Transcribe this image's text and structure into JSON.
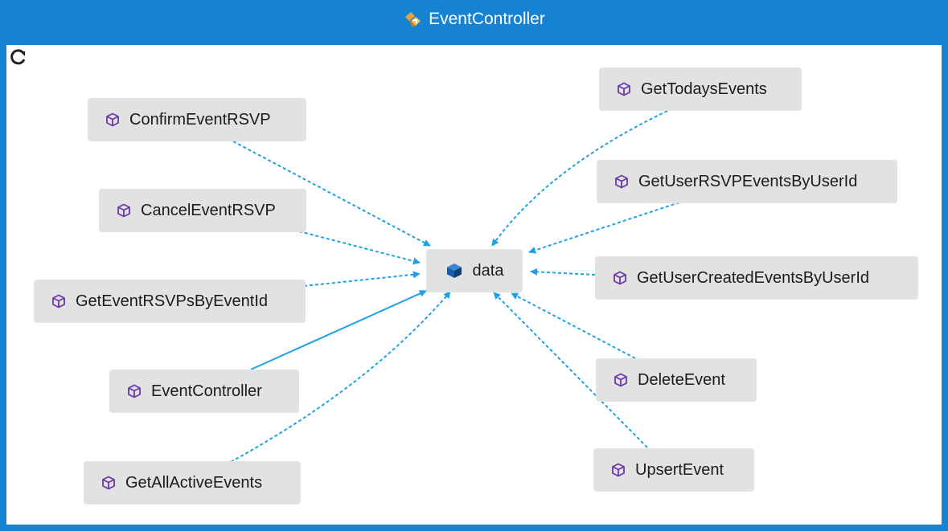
{
  "window": {
    "title": "EventController"
  },
  "colors": {
    "frame": "#1682d2",
    "node_fill": "#e2e2e2",
    "link": "#1ea1e6",
    "method_icon": "#6a3aa7",
    "field_icon": "#1a5ca8"
  },
  "icons": {
    "title": "class-diagram-icon",
    "refresh": "refresh-icon",
    "method": "method-cube-icon",
    "field": "field-cube-icon"
  },
  "diagram": {
    "center_node": {
      "label": "data"
    },
    "nodes": {
      "confirm_event_rsvp": "ConfirmEventRSVP",
      "cancel_event_rsvp": "CancelEventRSVP",
      "get_event_rsvps_by_event_id": "GetEventRSVPsByEventId",
      "event_controller": "EventController",
      "get_all_active_events": "GetAllActiveEvents",
      "get_todays_events": "GetTodaysEvents",
      "get_user_rsvp_events_by_user_id": "GetUserRSVPEventsByUserId",
      "get_user_created_events_by_user_id": "GetUserCreatedEventsByUserId",
      "delete_event": "DeleteEvent",
      "upsert_event": "UpsertEvent"
    }
  }
}
